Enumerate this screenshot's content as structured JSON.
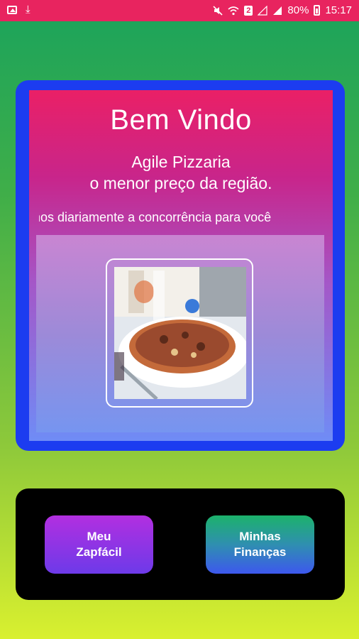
{
  "status_bar": {
    "left_icons": [
      "image-icon",
      "download-icon"
    ],
    "right_icons": [
      "mute-icon",
      "wifi-icon",
      "sim-badge-icon",
      "signal-icon",
      "signal-icon-2",
      "battery-icon"
    ],
    "sim_badge": "2",
    "battery": "80%",
    "time": "15:17"
  },
  "card": {
    "welcome": "Bem Vindo",
    "subtitle_line1": "Agile Pizzaria",
    "subtitle_line2": "o menor preço da região.",
    "marquee_text": "nos diariamente a concorrência para você",
    "photo_alt": "pizza-photo"
  },
  "buttons": {
    "left_label": "Meu\nZapfácil",
    "right_label": "Minhas\nFinanças"
  },
  "colors": {
    "status_bar": "#e8245f",
    "card_border": "#1c3cf0",
    "bottom_panel": "#000000"
  }
}
